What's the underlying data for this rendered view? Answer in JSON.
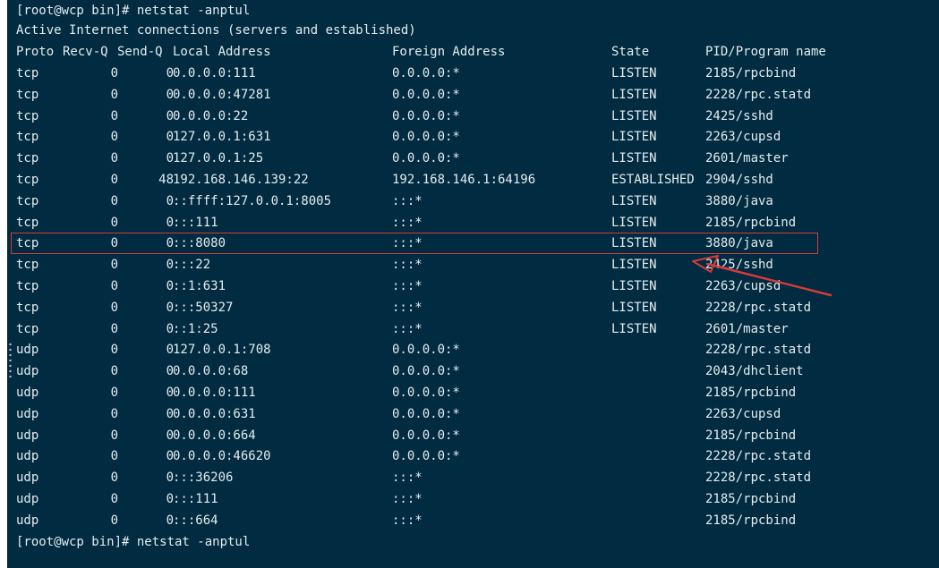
{
  "prompt_top": "[root@wcp bin]# netstat -anptul",
  "intro": "Active Internet connections (servers and established)",
  "header": {
    "proto": "Proto",
    "recv": "Recv-Q",
    "send": "Send-Q",
    "local": "Local Address",
    "foreign": "Foreign Address",
    "state": "State",
    "pid": "PID/Program name"
  },
  "rows": [
    {
      "proto": "tcp",
      "recv": "0",
      "send": "0",
      "local": "0.0.0.0:111",
      "foreign": "0.0.0.0:*",
      "state": "LISTEN",
      "pid": "2185/rpcbind"
    },
    {
      "proto": "tcp",
      "recv": "0",
      "send": "0",
      "local": "0.0.0.0:47281",
      "foreign": "0.0.0.0:*",
      "state": "LISTEN",
      "pid": "2228/rpc.statd"
    },
    {
      "proto": "tcp",
      "recv": "0",
      "send": "0",
      "local": "0.0.0.0:22",
      "foreign": "0.0.0.0:*",
      "state": "LISTEN",
      "pid": "2425/sshd"
    },
    {
      "proto": "tcp",
      "recv": "0",
      "send": "0",
      "local": "127.0.0.1:631",
      "foreign": "0.0.0.0:*",
      "state": "LISTEN",
      "pid": "2263/cupsd"
    },
    {
      "proto": "tcp",
      "recv": "0",
      "send": "0",
      "local": "127.0.0.1:25",
      "foreign": "0.0.0.0:*",
      "state": "LISTEN",
      "pid": "2601/master"
    },
    {
      "proto": "tcp",
      "recv": "0",
      "send": "48",
      "local": "192.168.146.139:22",
      "foreign": "192.168.146.1:64196",
      "state": "ESTABLISHED",
      "pid": "2904/sshd"
    },
    {
      "proto": "tcp",
      "recv": "0",
      "send": "0",
      "local": "::ffff:127.0.0.1:8005",
      "foreign": ":::*",
      "state": "LISTEN",
      "pid": "3880/java"
    },
    {
      "proto": "tcp",
      "recv": "0",
      "send": "0",
      "local": ":::111",
      "foreign": ":::*",
      "state": "LISTEN",
      "pid": "2185/rpcbind"
    },
    {
      "proto": "tcp",
      "recv": "0",
      "send": "0",
      "local": ":::8080",
      "foreign": ":::*",
      "state": "LISTEN",
      "pid": "3880/java"
    },
    {
      "proto": "tcp",
      "recv": "0",
      "send": "0",
      "local": ":::22",
      "foreign": ":::*",
      "state": "LISTEN",
      "pid": "2425/sshd"
    },
    {
      "proto": "tcp",
      "recv": "0",
      "send": "0",
      "local": "::1:631",
      "foreign": ":::*",
      "state": "LISTEN",
      "pid": "2263/cupsd"
    },
    {
      "proto": "tcp",
      "recv": "0",
      "send": "0",
      "local": ":::50327",
      "foreign": ":::*",
      "state": "LISTEN",
      "pid": "2228/rpc.statd"
    },
    {
      "proto": "tcp",
      "recv": "0",
      "send": "0",
      "local": "::1:25",
      "foreign": ":::*",
      "state": "LISTEN",
      "pid": "2601/master"
    },
    {
      "proto": "udp",
      "recv": "0",
      "send": "0",
      "local": "127.0.0.1:708",
      "foreign": "0.0.0.0:*",
      "state": "",
      "pid": "2228/rpc.statd"
    },
    {
      "proto": "udp",
      "recv": "0",
      "send": "0",
      "local": "0.0.0.0:68",
      "foreign": "0.0.0.0:*",
      "state": "",
      "pid": "2043/dhclient"
    },
    {
      "proto": "udp",
      "recv": "0",
      "send": "0",
      "local": "0.0.0.0:111",
      "foreign": "0.0.0.0:*",
      "state": "",
      "pid": "2185/rpcbind"
    },
    {
      "proto": "udp",
      "recv": "0",
      "send": "0",
      "local": "0.0.0.0:631",
      "foreign": "0.0.0.0:*",
      "state": "",
      "pid": "2263/cupsd"
    },
    {
      "proto": "udp",
      "recv": "0",
      "send": "0",
      "local": "0.0.0.0:664",
      "foreign": "0.0.0.0:*",
      "state": "",
      "pid": "2185/rpcbind"
    },
    {
      "proto": "udp",
      "recv": "0",
      "send": "0",
      "local": "0.0.0.0:46620",
      "foreign": "0.0.0.0:*",
      "state": "",
      "pid": "2228/rpc.statd"
    },
    {
      "proto": "udp",
      "recv": "0",
      "send": "0",
      "local": ":::36206",
      "foreign": ":::*",
      "state": "",
      "pid": "2228/rpc.statd"
    },
    {
      "proto": "udp",
      "recv": "0",
      "send": "0",
      "local": ":::111",
      "foreign": ":::*",
      "state": "",
      "pid": "2185/rpcbind"
    },
    {
      "proto": "udp",
      "recv": "0",
      "send": "0",
      "local": ":::664",
      "foreign": ":::*",
      "state": "",
      "pid": "2185/rpcbind"
    }
  ],
  "prompt_bottom": "[root@wcp bin]# netstat -anptul",
  "annotation": {
    "highlight_color": "#d63a3a",
    "highlighted_row": 8,
    "arrow_icon": "red-arrow-icon"
  },
  "colors": {
    "terminal_bg": "#002b40",
    "text": "#e6ecef"
  }
}
